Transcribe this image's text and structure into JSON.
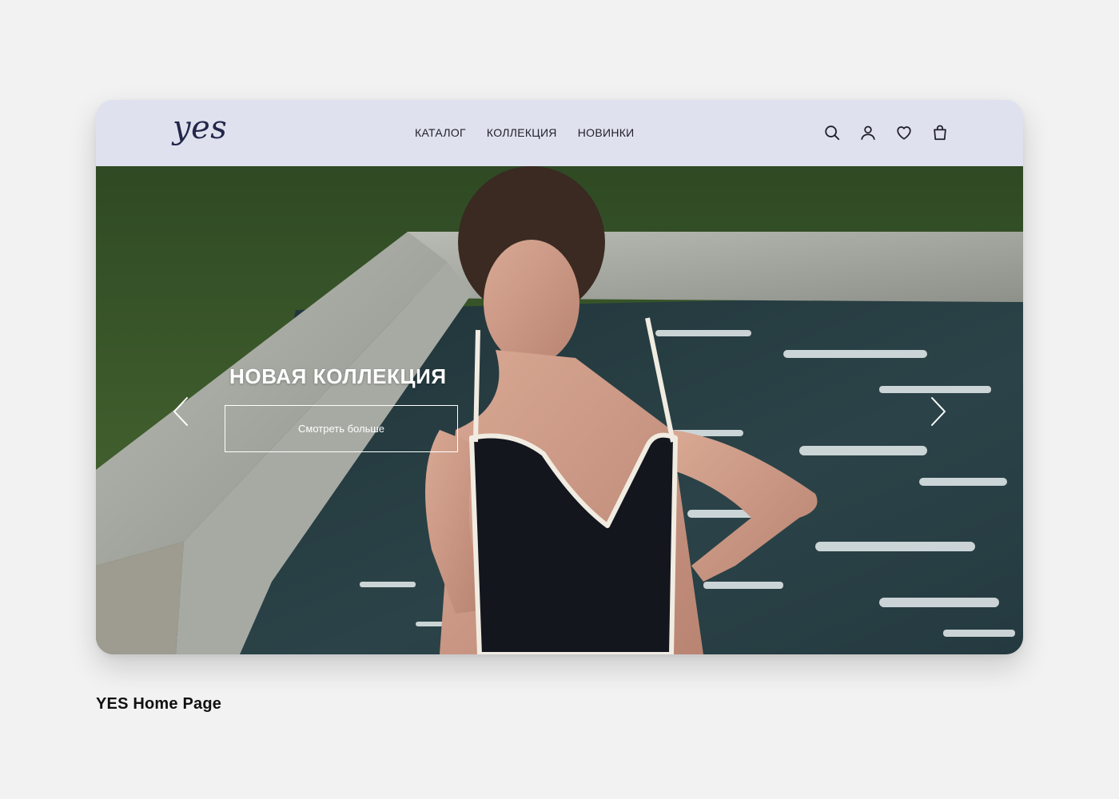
{
  "header": {
    "logo": "yes",
    "nav": [
      {
        "label": "КАТАЛОГ"
      },
      {
        "label": "КОЛЛЕКЦИЯ"
      },
      {
        "label": "НОВИНКИ"
      }
    ],
    "icons": [
      "search-icon",
      "user-icon",
      "heart-icon",
      "bag-icon"
    ]
  },
  "hero": {
    "title": "НОВАЯ КОЛЛЕКЦИЯ",
    "cta_label": "Смотреть больше",
    "image_subject": "woman in black swimsuit standing in pool beside stone edge and grass"
  },
  "caption": "YES Home Page",
  "colors": {
    "page_bg": "#f2f2f2",
    "header_bg": "#dfe2ee",
    "logo": "#23264a",
    "nav_text": "#1e1e28",
    "hero_text": "#ffffff"
  }
}
